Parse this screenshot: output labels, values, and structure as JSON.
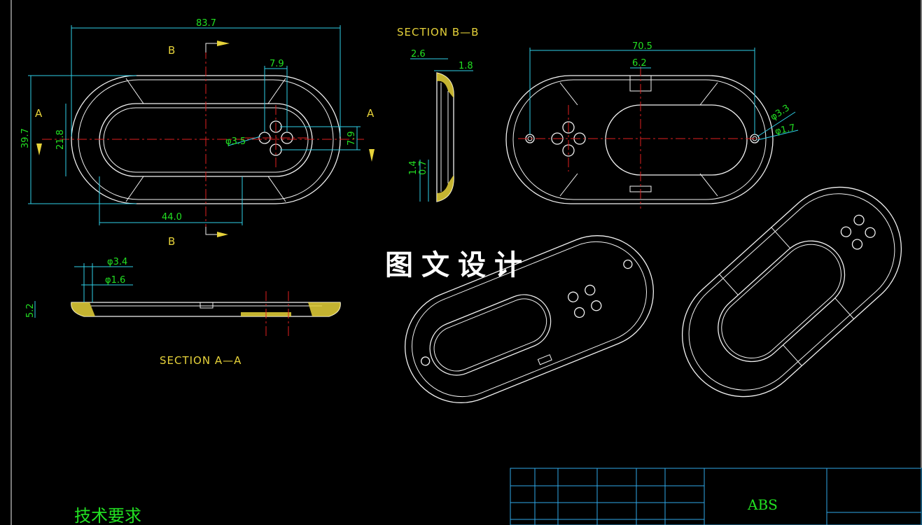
{
  "view_labels": {
    "section_a": "A",
    "section_b": "B",
    "section_aa": "SECTION  A—A",
    "section_bb": "SECTION  B—B"
  },
  "dimensions": {
    "front_width": "83.7",
    "front_height": "39.7",
    "inner_height": "21.8",
    "inner_length": "44.0",
    "hole_spacing": "7.9",
    "hole_spacing_v": "7.9",
    "hole_dia": "φ3.5",
    "aa_dia_outer": "φ3.4",
    "aa_dia_inner": "φ1.6",
    "aa_thickness": "5.2",
    "bb_d1": "2.6",
    "bb_d2": "1.8",
    "bb_d3": "1.4",
    "bb_d4": "0.7",
    "back_width": "70.5",
    "back_tab": "6.2",
    "back_dia_outer": "φ3.3",
    "back_dia_inner": "φ1.7"
  },
  "watermark": "图文设计",
  "title_block": {
    "material": "ABS",
    "tech_requirements": "技术要求"
  }
}
